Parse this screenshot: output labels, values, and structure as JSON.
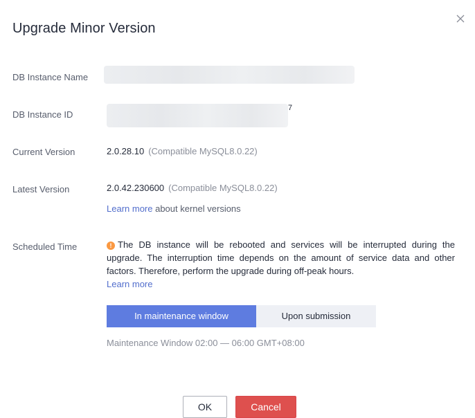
{
  "dialog": {
    "title": "Upgrade Minor Version",
    "close_icon": "close-icon"
  },
  "fields": {
    "instance_name_label": "DB Instance Name",
    "instance_id_label": "DB Instance ID",
    "instance_id_trailing": "7",
    "current_version_label": "Current Version",
    "current_version_value": "2.0.28.10",
    "current_version_compat": "(Compatible MySQL8.0.22)",
    "latest_version_label": "Latest Version",
    "latest_version_value": "2.0.42.230600",
    "latest_version_compat": "(Compatible MySQL8.0.22)",
    "kernel_link": "Learn more",
    "kernel_note": " about kernel versions",
    "scheduled_time_label": "Scheduled Time"
  },
  "warning": {
    "icon": "warning-icon",
    "icon_glyph": "!",
    "text": "The DB instance will be rebooted and services will be interrupted during the upgrade. The interruption time depends on the amount of service data and other factors. Therefore, perform the upgrade during off-peak hours.",
    "link": "Learn more"
  },
  "schedule": {
    "options": [
      "In maintenance window",
      "Upon submission"
    ],
    "selected": "In maintenance window",
    "maintenance_window": "Maintenance Window 02:00 — 06:00 GMT+08:00"
  },
  "footer": {
    "ok_label": "OK",
    "cancel_label": "Cancel"
  },
  "colors": {
    "primary": "#5e7ce0",
    "danger": "#de504e",
    "warning": "#fa9841",
    "link": "#526ecc"
  }
}
